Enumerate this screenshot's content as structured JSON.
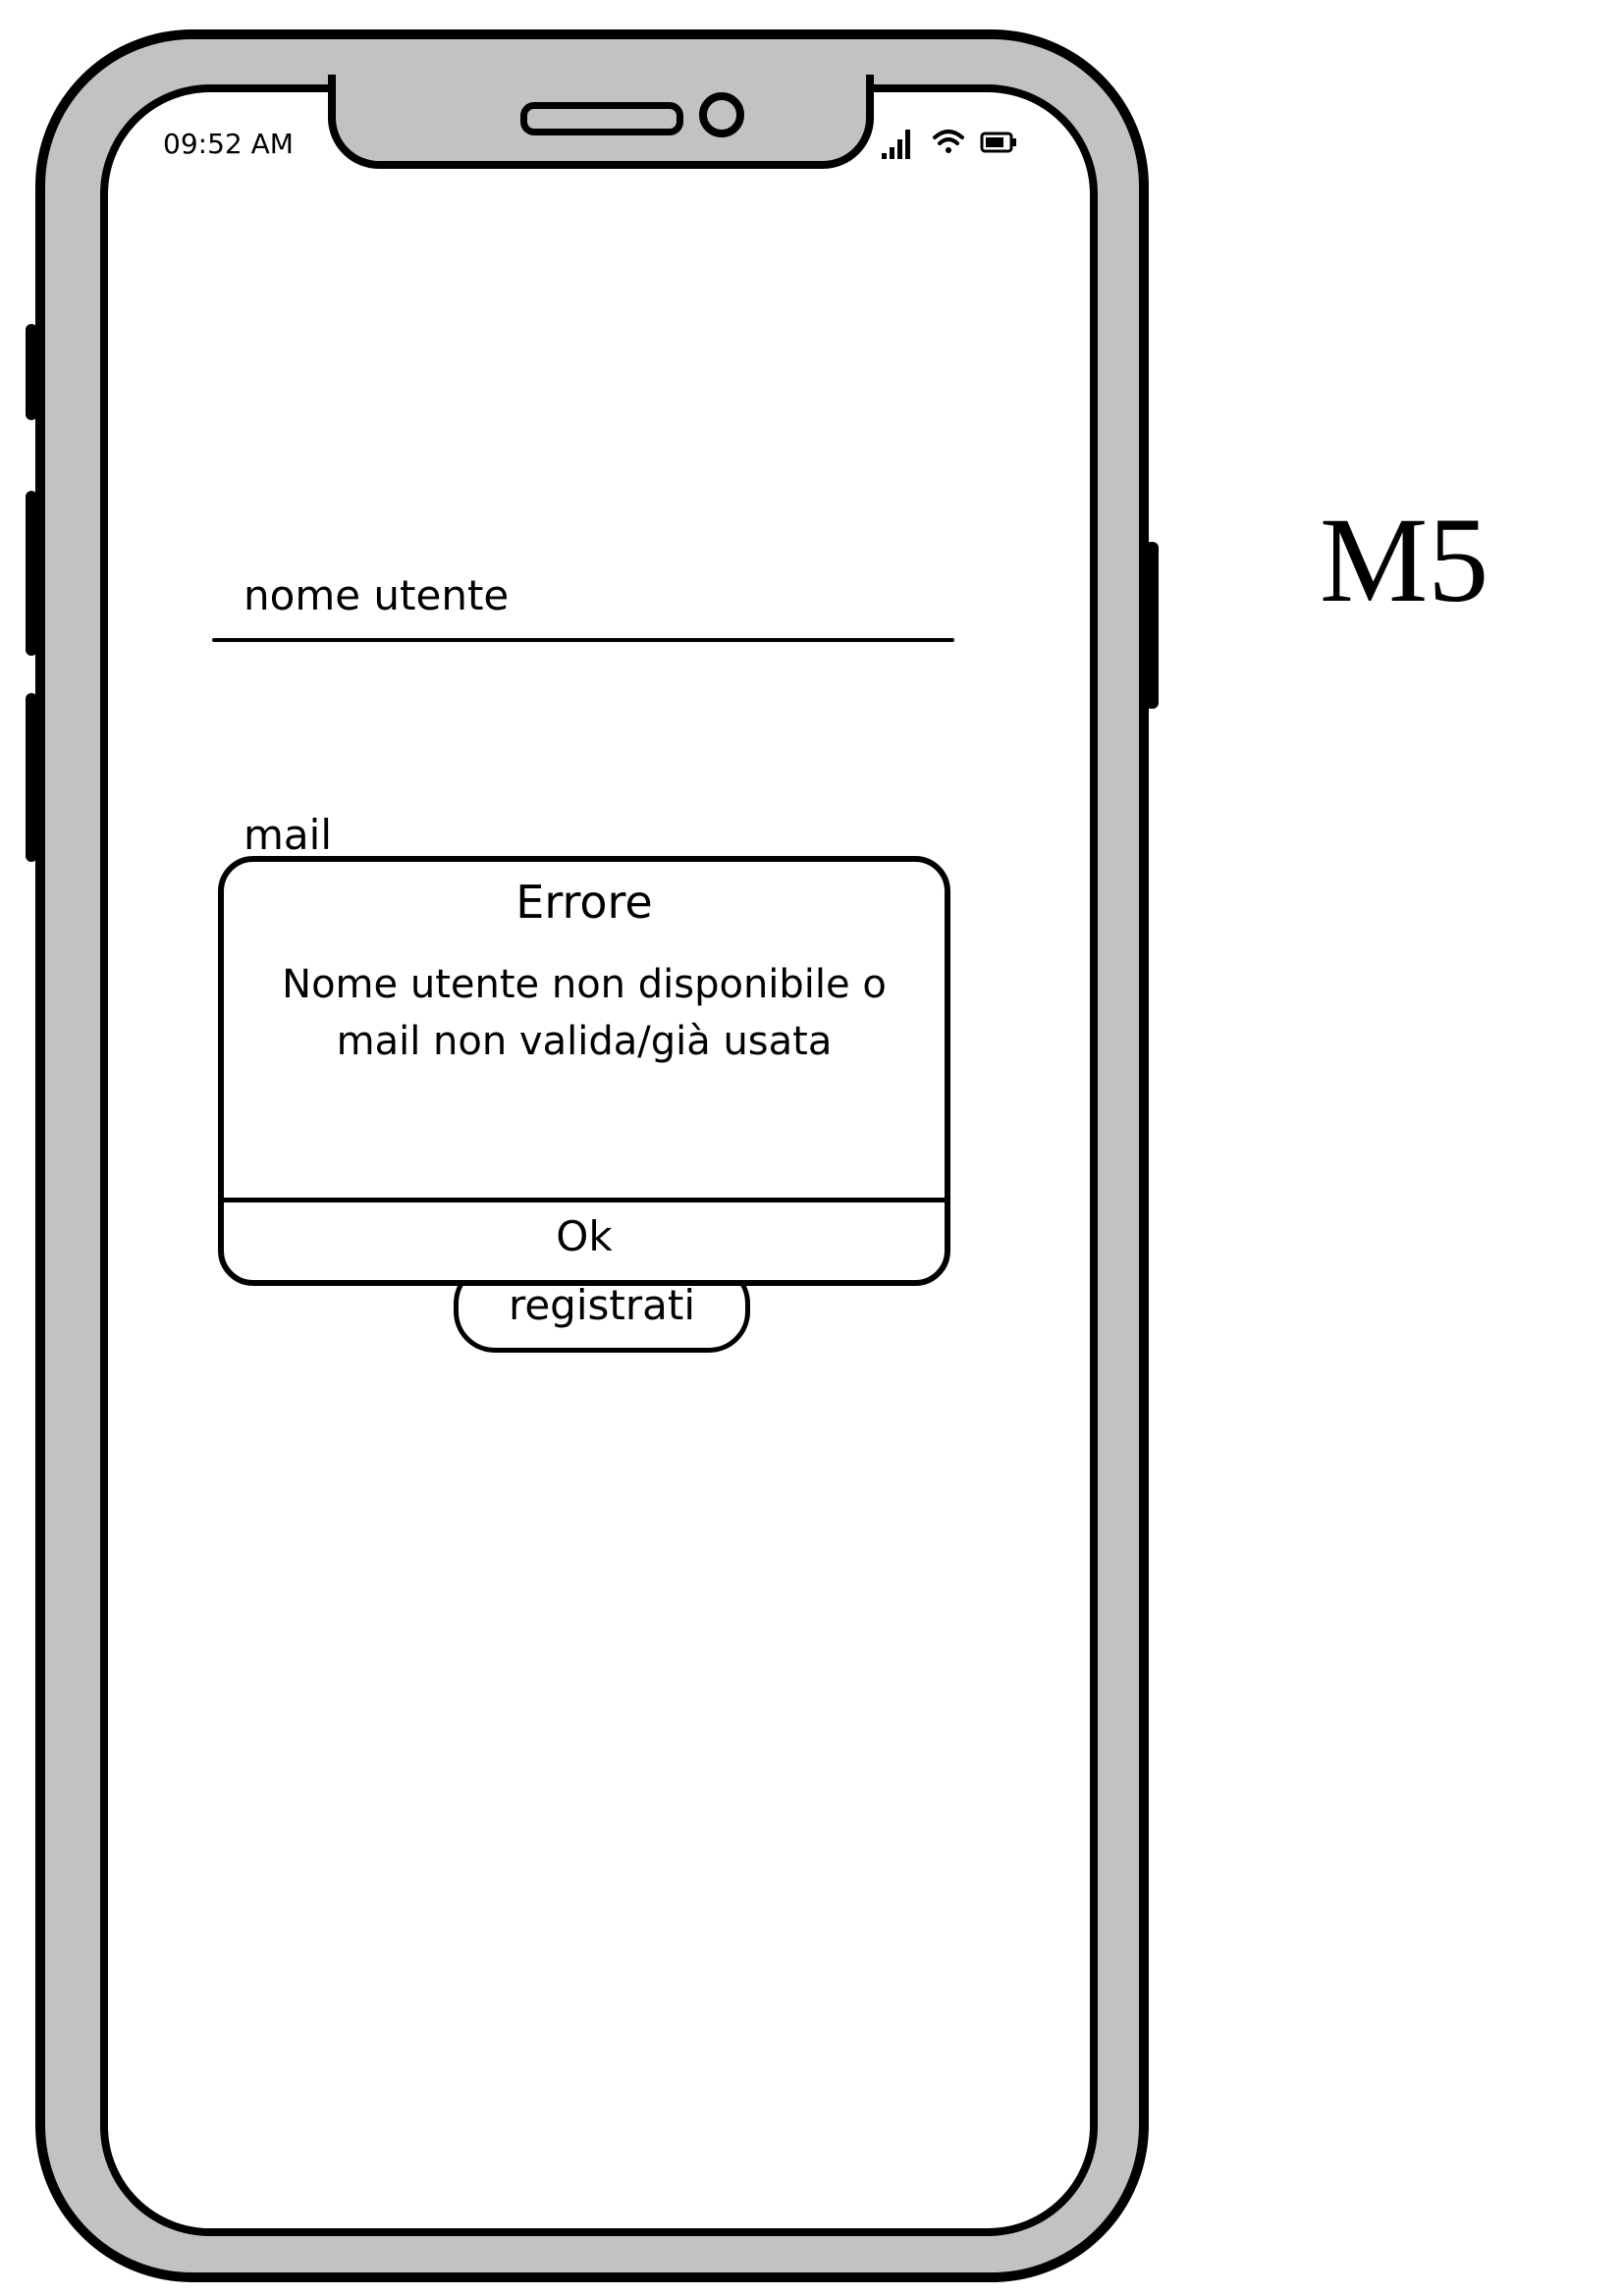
{
  "status_bar": {
    "time": "09:52 AM",
    "icons": [
      "signal-icon",
      "wifi-icon",
      "battery-icon"
    ]
  },
  "form": {
    "username_placeholder": "nome utente",
    "mail_placeholder": "mail",
    "register_label": "registrati"
  },
  "dialog": {
    "title": "Errore",
    "message_line_1": "Nome utente non disponibile o",
    "message_line_2": "mail non valida/già usata",
    "ok_label": "Ok"
  },
  "screen_id": "M5",
  "colors": {
    "frame": "#c2c2c2",
    "outline": "#000000",
    "screen": "#ffffff"
  }
}
